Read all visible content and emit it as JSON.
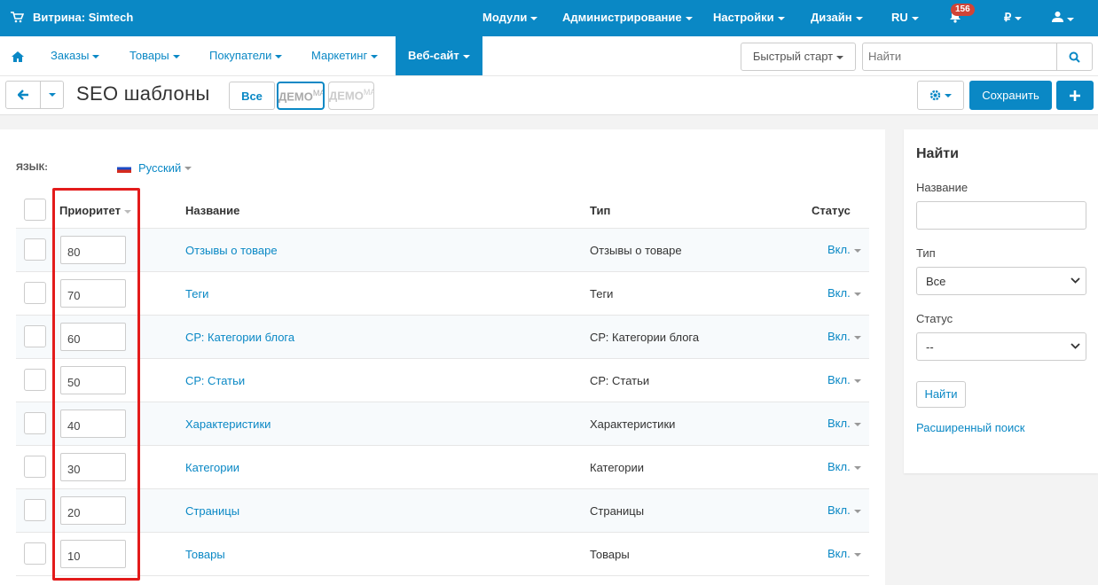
{
  "topbar": {
    "store": "Витрина: Simtech",
    "menu": [
      "Модули",
      "Администрирование",
      "Настройки",
      "Дизайн",
      "RU",
      "₽"
    ],
    "notifications": "156"
  },
  "nav": {
    "items": [
      "Заказы",
      "Товары",
      "Покупатели",
      "Маркетинг",
      "Веб-сайт"
    ],
    "quick_start": "Быстрый старт",
    "search_placeholder": "Найти"
  },
  "toolbar": {
    "title": "SEO шаблоны",
    "filter_all": "Все",
    "demo1": "ДЕМО",
    "demo1_sup": "МА",
    "demo2": "ДЕМО",
    "demo2_sup": "МА",
    "save": "Сохранить"
  },
  "language": {
    "label": "ЯЗЫК:",
    "value": "Русский"
  },
  "table": {
    "headers": {
      "priority": "Приоритет",
      "name": "Название",
      "type": "Тип",
      "status": "Статус"
    },
    "rows": [
      {
        "priority": "80",
        "name": "Отзывы о товаре",
        "type": "Отзывы о товаре",
        "status": "Вкл."
      },
      {
        "priority": "70",
        "name": "Теги",
        "type": "Теги",
        "status": "Вкл."
      },
      {
        "priority": "60",
        "name": "СР: Категории блога",
        "type": "СР: Категории блога",
        "status": "Вкл."
      },
      {
        "priority": "50",
        "name": "СР: Статьи",
        "type": "СР: Статьи",
        "status": "Вкл."
      },
      {
        "priority": "40",
        "name": "Характеристики",
        "type": "Характеристики",
        "status": "Вкл."
      },
      {
        "priority": "30",
        "name": "Категории",
        "type": "Категории",
        "status": "Вкл."
      },
      {
        "priority": "20",
        "name": "Страницы",
        "type": "Страницы",
        "status": "Вкл."
      },
      {
        "priority": "10",
        "name": "Товары",
        "type": "Товары",
        "status": "Вкл."
      }
    ]
  },
  "sidebar": {
    "title": "Найти",
    "name_label": "Название",
    "name_value": "",
    "type_label": "Тип",
    "type_value": "Все",
    "status_label": "Статус",
    "status_value": "--",
    "find_button": "Найти",
    "advanced": "Расширенный поиск"
  },
  "colors": {
    "primary": "#0a88c5",
    "highlight": "#e31b1b",
    "badge": "#d04437"
  }
}
